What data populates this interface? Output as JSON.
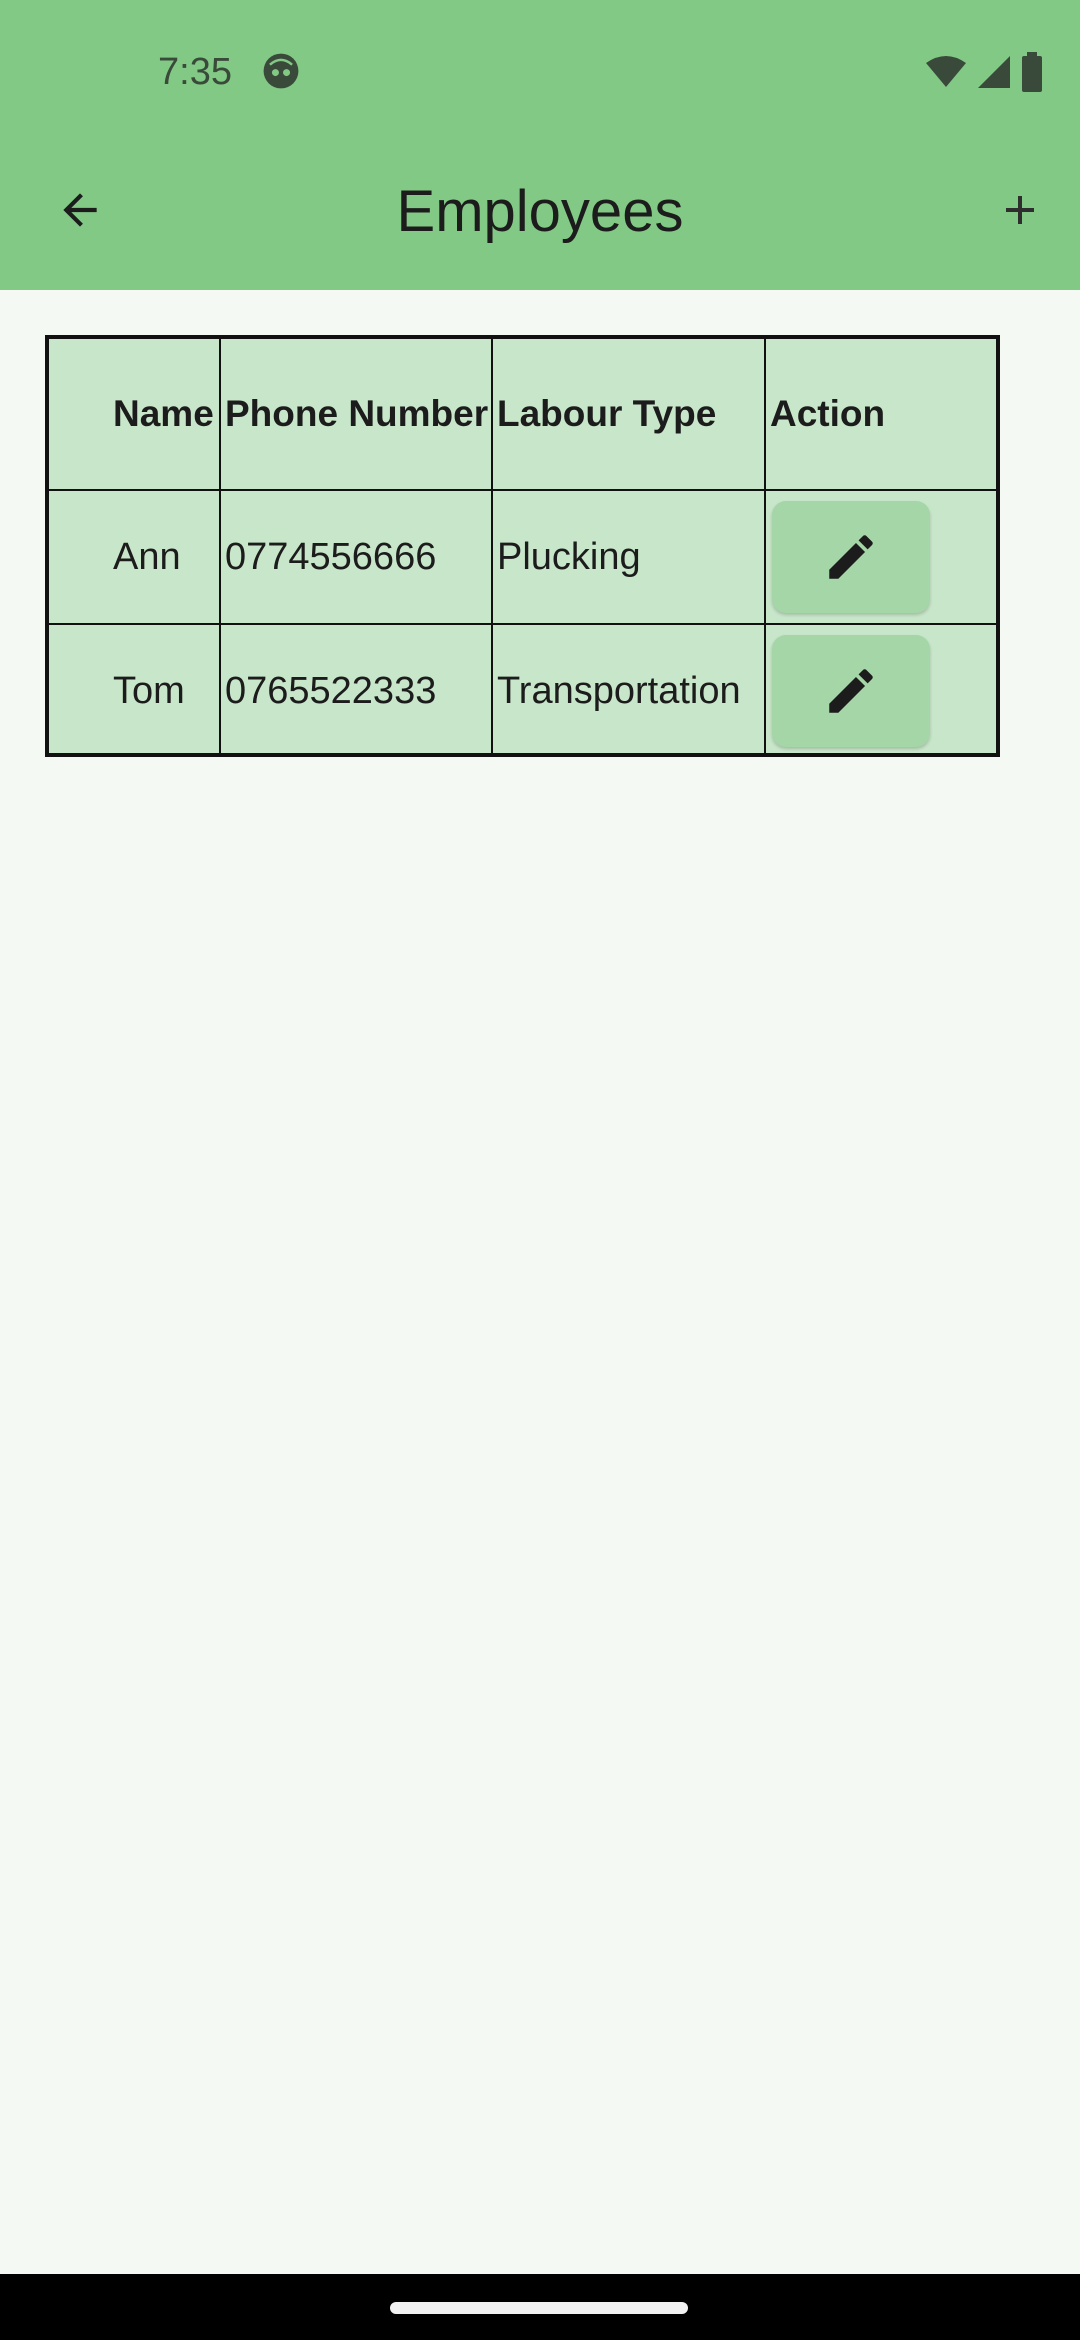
{
  "status_bar": {
    "time": "7:35",
    "icons": [
      "face-icon",
      "wifi-icon",
      "signal-icon",
      "battery-icon"
    ]
  },
  "app_bar": {
    "title": "Employees",
    "back_icon": "arrow-left-icon",
    "add_icon": "plus-icon"
  },
  "table": {
    "headers": [
      "Name",
      "Phone Number",
      "Labour Type",
      "Action"
    ],
    "rows": [
      {
        "name": "Ann",
        "phone": "0774556666",
        "labour_type": "Plucking",
        "action_icon": "pencil-icon"
      },
      {
        "name": "Tom",
        "phone": "0765522333",
        "labour_type": "Transportation",
        "action_icon": "pencil-icon"
      }
    ]
  },
  "colors": {
    "app_bar": "#82c985",
    "background": "#f4f9f3",
    "table_fill": "#c8e6c9",
    "edit_button": "#a5d6a7"
  }
}
